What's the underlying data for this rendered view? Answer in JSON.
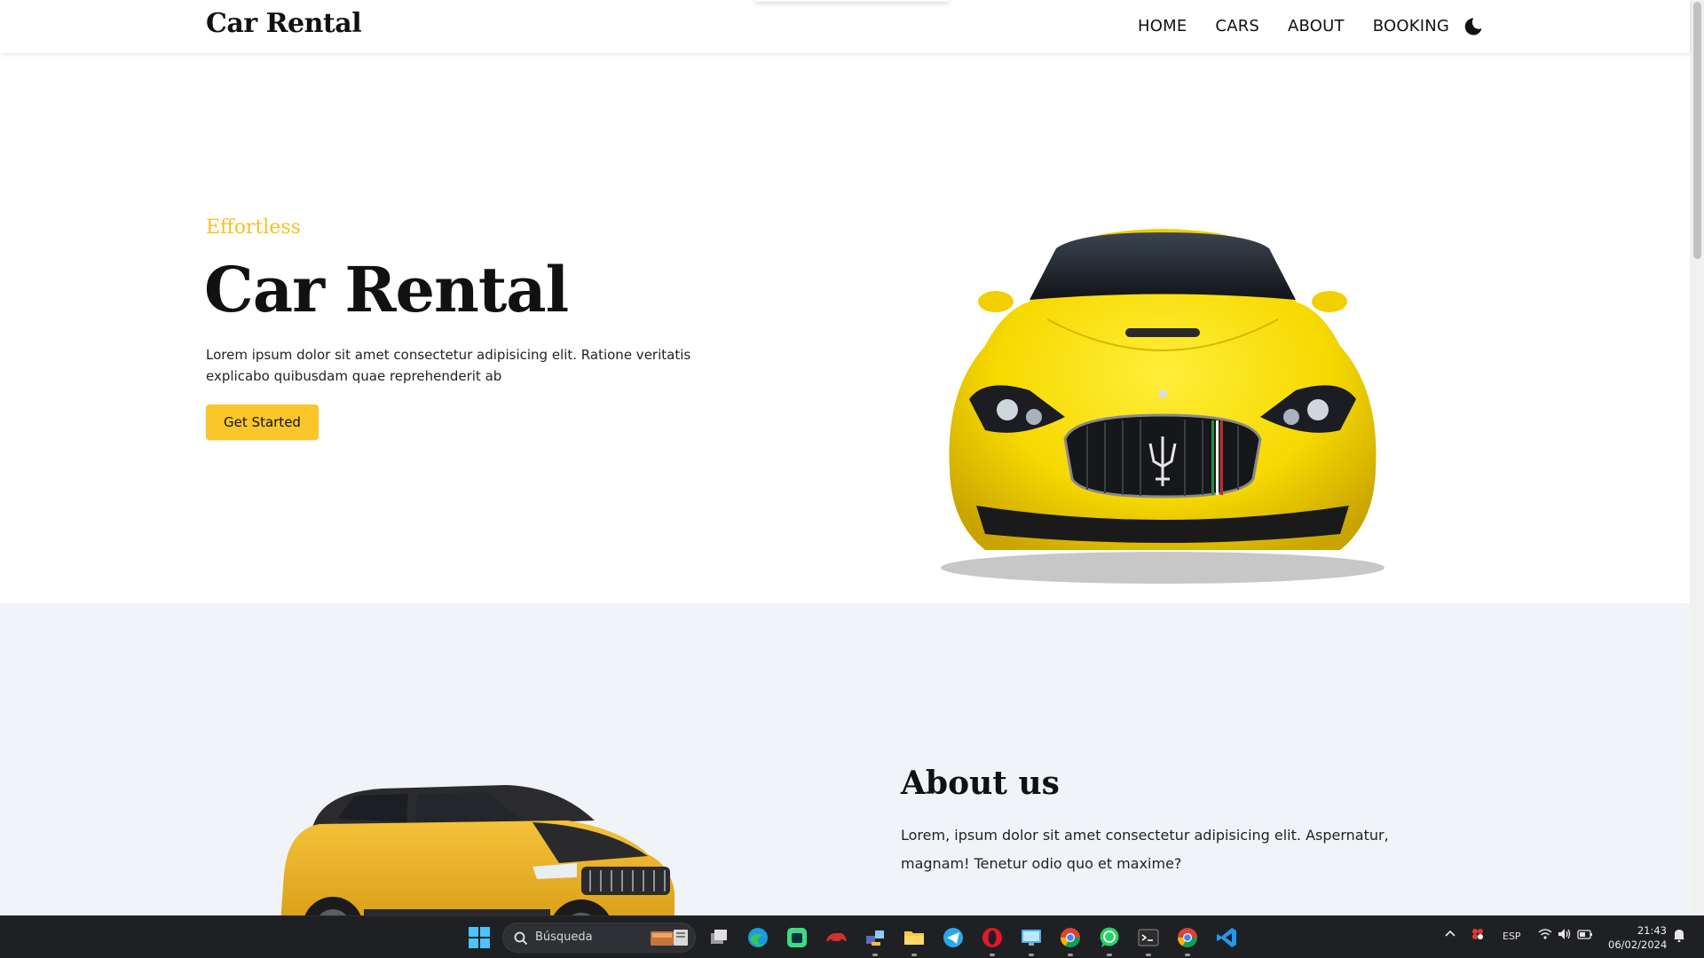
{
  "header": {
    "logo": "Car Rental",
    "nav": [
      {
        "label": "HOME"
      },
      {
        "label": "CARS"
      },
      {
        "label": "ABOUT"
      },
      {
        "label": "BOOKING"
      }
    ],
    "theme_toggle_icon": "moon-icon"
  },
  "hero": {
    "eyebrow": "Effortless",
    "title": "Car Rental",
    "description": "Lorem ipsum dolor sit amet consectetur adipisicing elit. Ratione veritatis explicabo quibusdam quae reprehenderit ab",
    "cta_label": "Get Started",
    "image": "yellow-sports-car"
  },
  "about": {
    "title": "About us",
    "text": "Lorem, ipsum dolor sit amet consectetur adipisicing elit. Aspernatur, magnam! Tenetur odio quo et maxime?",
    "image": "yellow-suv"
  },
  "taskbar": {
    "search_placeholder": "Búsqueda",
    "apps": [
      "file-view-icon",
      "edge-icon",
      "android-studio-icon",
      "car-app-icon",
      "network-app-icon",
      "file-explorer-icon",
      "telegram-icon",
      "opera-icon",
      "remote-desktop-icon",
      "chrome-icon",
      "whatsapp-icon",
      "terminal-icon",
      "chrome-alt-icon",
      "vscode-icon"
    ],
    "language": "ESP",
    "time": "21:43",
    "date": "06/02/2024"
  },
  "colors": {
    "accent": "#f9c62b",
    "eyebrow": "#f5c225",
    "about_bg": "#f0f3f8",
    "taskbar_bg": "#1f2023"
  }
}
